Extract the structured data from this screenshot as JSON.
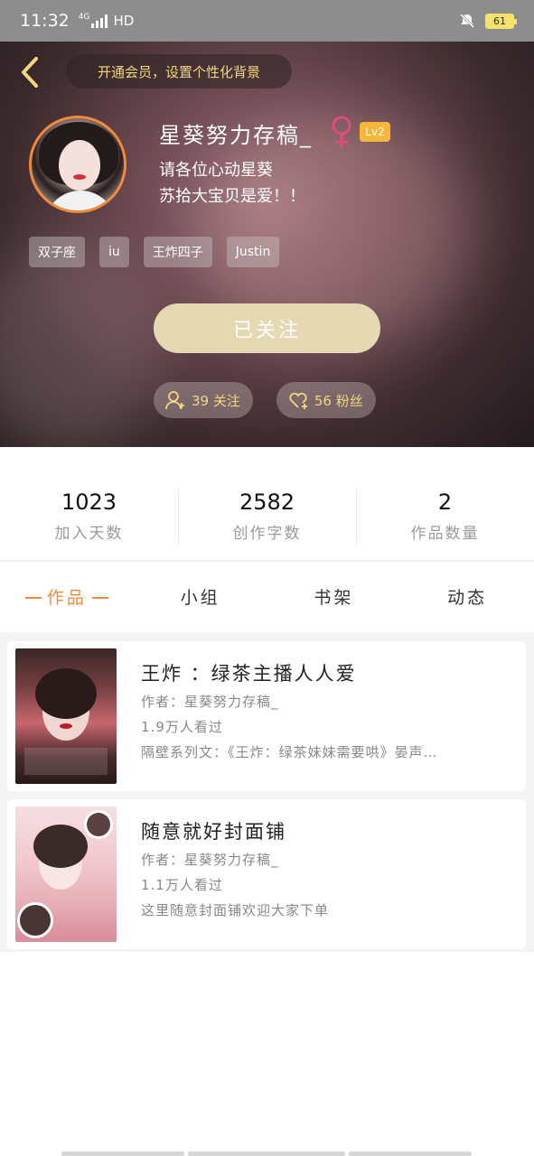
{
  "status_bar": {
    "time": "11:32",
    "network": "4G",
    "hd": "HD",
    "battery": "61"
  },
  "header": {
    "vip_prompt": "开通会员，设置个性化背景",
    "nickname": "星葵努力存稿_",
    "level": "Lv2",
    "bio_lines": [
      "请各位心动星葵",
      "苏拾大宝贝是爱！！"
    ],
    "tags": [
      "双子座",
      "iu",
      "王炸四子",
      "Justin"
    ],
    "follow_button": "已关注",
    "following_count": "39 关注",
    "fans_count": "56 粉丝"
  },
  "stats": [
    {
      "value": "1023",
      "label": "加入天数"
    },
    {
      "value": "2582",
      "label": "创作字数"
    },
    {
      "value": "2",
      "label": "作品数量"
    }
  ],
  "tabs": [
    {
      "label": "作品",
      "active": true
    },
    {
      "label": "小组",
      "active": false
    },
    {
      "label": "书架",
      "active": false
    },
    {
      "label": "动态",
      "active": false
    }
  ],
  "works": [
    {
      "title": "王炸 ：绿茶主播人人爱",
      "author": "作者：星葵努力存稿_",
      "views": "1.9万人看过",
      "desc": "隔壁系列文：《王炸：绿茶妹妹需要哄》晏声…"
    },
    {
      "title": "随意就好封面铺",
      "author": "作者：星葵努力存稿_",
      "views": "1.1万人看过",
      "desc": "这里随意封面铺欢迎大家下单"
    }
  ],
  "colors": {
    "accent": "#f08a3c",
    "gold": "#f2d780",
    "follow_btn": "#e5d9b4",
    "level_badge": "#f4b73a"
  }
}
